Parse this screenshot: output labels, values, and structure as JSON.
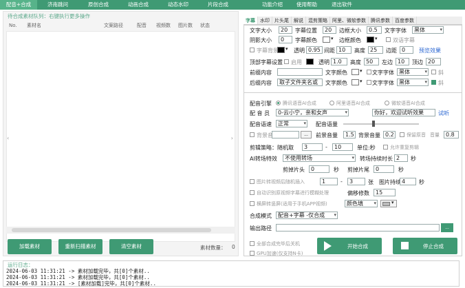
{
  "topnav": {
    "items": [
      "配音+合成",
      "济南跳问",
      "原创合成",
      "动画合成",
      "动态水印",
      "片段合成",
      "功能介绍",
      "使用帮助",
      "退出软件"
    ]
  },
  "leftpanel": {
    "queue_title": "待合成素材队列：右键执行更多操作",
    "columns": [
      "No.",
      "素材名",
      "文案路径",
      "配音",
      "视频数",
      "图片数",
      "状态"
    ],
    "buttons": {
      "load": "加载素材",
      "rescan": "重新扫描素材",
      "clear": "清空素材"
    },
    "count_label": "素材数量：",
    "count_value": "0"
  },
  "tabs": [
    "字幕",
    "水印",
    "片头尾",
    "解说",
    "混剪策略",
    "阿里、微软参数",
    "腾讯参数",
    "百度参数"
  ],
  "subtitle": {
    "font_size_label": "文字大小",
    "font_size": "20",
    "subtitle_pos_label": "字幕位置",
    "subtitle_pos": "20",
    "border_size_label": "边框大小",
    "border_size": "0.5",
    "font_label": "文字字体",
    "font_value": "黑体",
    "shadow_label": "阴影大小",
    "shadow": "0",
    "subtitle_color_label": "字幕颜色",
    "border_color_label": "边框颜色",
    "double_sub_label": "双语字幕",
    "sub_bg_label": "字幕背景",
    "opacity_label": "透明",
    "opacity1": "0.95",
    "spacing_label": "间距",
    "spacing": "10",
    "height_label": "高度",
    "height1": "25",
    "margin_label": "边距",
    "margin": "0",
    "preview_label": "预览效果",
    "top_sub_label": "顶部字幕设置",
    "enable_label": "启用",
    "opacity2": "1.0",
    "height2": "50",
    "left_right_label": "左边",
    "left_right": "10",
    "top_margin_label": "顶边",
    "top_margin": "20",
    "pre_content_label": "前缀内容",
    "text_color_label": "文字颜色",
    "text_font_label": "文字字体",
    "text_font_value": "黑体",
    "bold_label": "斜",
    "post_content_label": "后缀内容",
    "post_content": "取子文件夹名或",
    "text_font_value2": "黑体"
  },
  "synth": {
    "engine_label": "配音引擎",
    "engine_options": [
      "腾讯语音AI合成",
      "阿里语音AI合成",
      "微软语音AI合成"
    ],
    "voice_label": "配 音 员",
    "voice_value": "0-云小宁，亲和女声",
    "test_text": "你好，欢迎试听效果",
    "test_btn": "试听",
    "speed_label": "配音语速",
    "speed_value": "正常",
    "volume_label": "配音语量",
    "bgm_label": "背景音",
    "bgm_btn": "...",
    "front_vol_label": "前景音量",
    "front_vol": "1.5",
    "back_vol_label": "背景音量",
    "back_vol": "0.2",
    "keep_orig_label": "保留原音",
    "vol_label": "音量",
    "vol_value": "0.8",
    "cut_label": "剪辑策略：随机取",
    "cut_from": "3",
    "cut_dash": "-",
    "cut_to": "10",
    "unit_label": "单位:秒",
    "allow_repeat_label": "允许重复剪辑",
    "ai_trans_label": "AI转场特效",
    "ai_trans_value": "不使用转场",
    "trans_dur_label": "转场持续时长",
    "trans_dur": "2",
    "sec": "秒",
    "cut_head_label": "剪掉片头",
    "cut_head": "0",
    "cut_tail_label": "剪掉片尾",
    "cut_tail": "0",
    "img_random_label": "图片转视频后随机插入",
    "img_from": "1",
    "img_to": "3",
    "img_unit": "张",
    "img_dur_label": "图片持续",
    "img_dur": "4",
    "auto_detect_label": "自动识别原视频字幕进行模糊处理",
    "offset_label": "偏移修数",
    "offset_value": "15",
    "hscreen_label": "横屏转竖屏(适用于手机APP视频)",
    "color_fill_value": "颜色填",
    "mode_label": "合成模式",
    "mode_value": "配音+字幕 -仅合成",
    "output_label": "输出路径",
    "output_btn": "...",
    "shutdown_label": "全部合成完毕后关机",
    "gpu_label": "GPU加速(仅支持N卡)",
    "start_btn": "开始合成",
    "stop_btn": "停止合成"
  },
  "log": {
    "title": "运行日志：",
    "lines": [
      "2024-06-03 11:31:21 -> 素材加载完毕，共[0]个素材..",
      "2024-06-03 11:31:21 -> 素材加载完毕，共[0]个素材..",
      "2024-06-03 11:31:21 -> [素材加载]完毕，共[0]个素材.."
    ]
  },
  "colors": {
    "accent": "#3f9a74",
    "link": "#2a66d2",
    "section": "#5aa88a"
  }
}
